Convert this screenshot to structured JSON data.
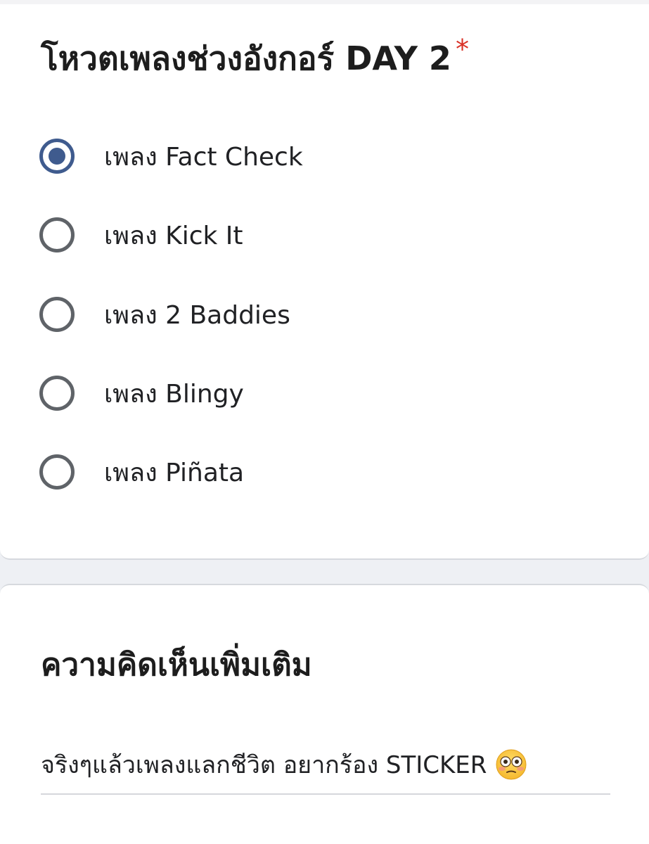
{
  "question": {
    "title": "โหวตเพลงช่วงอังกอร์ DAY 2",
    "required_mark": "*"
  },
  "options": [
    {
      "label": "เพลง Fact Check",
      "selected": true
    },
    {
      "label": "เพลง Kick It",
      "selected": false
    },
    {
      "label": "เพลง 2 Baddies",
      "selected": false
    },
    {
      "label": "เพลง Blingy",
      "selected": false
    },
    {
      "label": "เพลง Piñata",
      "selected": false
    }
  ],
  "comment_section": {
    "title": "ความคิดเห็นเพิ่มเติม",
    "answer": "จริงๆแล้วเพลงแลกชีวิต อยากร้อง STICKER",
    "answer_emoji": "flushed-face-emoji"
  },
  "colors": {
    "accent": "#3f5b8e",
    "required": "#d93025",
    "radio_border": "#5f6368"
  }
}
